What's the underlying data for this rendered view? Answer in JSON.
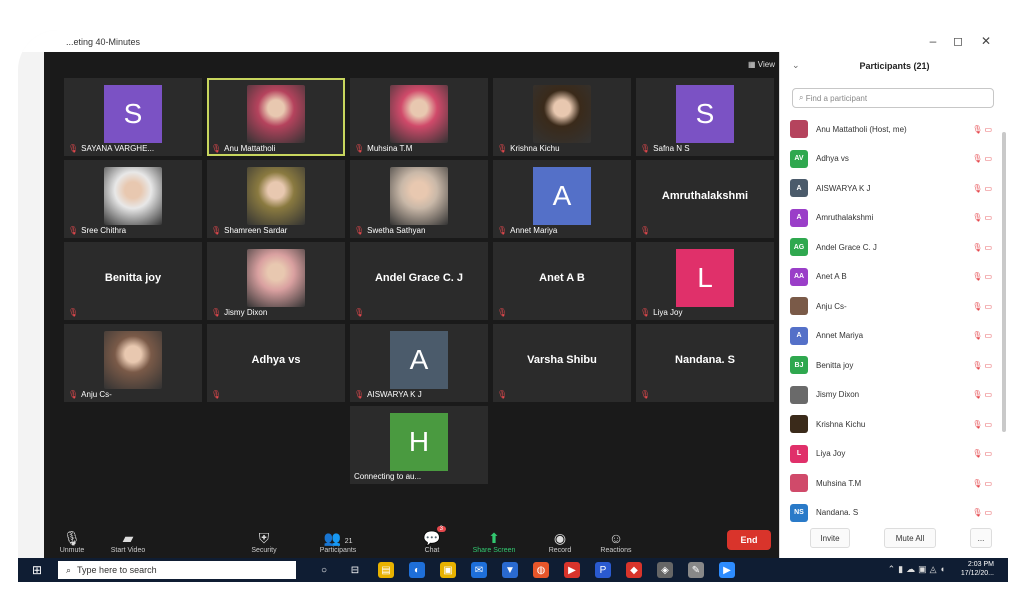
{
  "window": {
    "title": "...eting 40-Minutes",
    "minimize_icon": "–",
    "restore_icon": "◻",
    "close_icon": "✕"
  },
  "meeting": {
    "view_label": "View",
    "tiles": [
      {
        "name": "SAYANA VARGHE...",
        "avatar": "S",
        "color": "#7b52c4"
      },
      {
        "name": "Anu Mattatholi",
        "photo": true,
        "color": "#b5435d",
        "active": true
      },
      {
        "name": "Muhsina T.M",
        "photo": true,
        "color": "#d04a6a"
      },
      {
        "name": "Krishna Kichu",
        "photo": true,
        "color": "#3a2a1a"
      },
      {
        "name": "Safna N S",
        "avatar": "S",
        "color": "#7b52c4"
      },
      {
        "name": "Sree Chithra",
        "photo": true,
        "color": "#e8e8e8"
      },
      {
        "name": "Shamreen Sardar",
        "photo": true,
        "color": "#8a7a40"
      },
      {
        "name": "Swetha Sathyan",
        "photo": true,
        "color": "#c9b8a8"
      },
      {
        "name": "Annet Mariya",
        "avatar": "A",
        "color": "#5470c8"
      },
      {
        "name": "",
        "bigname": "Amruthalakshmi"
      },
      {
        "name": "",
        "bigname": "Benitta joy"
      },
      {
        "name": "Jismy Dixon",
        "photo": true,
        "color": "#d9a0a0"
      },
      {
        "name": "",
        "bigname": "Andel Grace  C. J"
      },
      {
        "name": "",
        "bigname": "Anet A B"
      },
      {
        "name": "Liya Joy",
        "avatar": "L",
        "color": "#e0306a"
      },
      {
        "name": "Anju Cs-",
        "photo": true,
        "color": "#7a5a48"
      },
      {
        "name": "",
        "bigname": "Adhya vs"
      },
      {
        "name": "AISWARYA K J",
        "avatar": "A",
        "color": "#4b5b6b"
      },
      {
        "name": "",
        "bigname": "Varsha Shibu"
      },
      {
        "name": "",
        "bigname": "Nandana. S"
      },
      {
        "name": "Connecting to au...",
        "avatar": "H",
        "color": "#4a9a40",
        "nomic": true
      }
    ]
  },
  "toolbar": {
    "unmute": "Unmute",
    "start_video": "Start Video",
    "security": "Security",
    "participants": "Participants",
    "participants_count": "21",
    "chat": "Chat",
    "chat_badge": "3",
    "share_screen": "Share Screen",
    "record": "Record",
    "reactions": "Reactions",
    "end": "End"
  },
  "panel": {
    "title": "Participants (21)",
    "search_placeholder": "Find a participant",
    "participants": [
      {
        "name": "Anu Mattatholi (Host, me)",
        "initials": "",
        "color": "#b5435d"
      },
      {
        "name": "Adhya vs",
        "initials": "AV",
        "color": "#2fa84f"
      },
      {
        "name": "AISWARYA K J",
        "initials": "A",
        "color": "#4b5b6b"
      },
      {
        "name": "Amruthalakshmi",
        "initials": "A",
        "color": "#9a3ec8"
      },
      {
        "name": "Andel Grace  C. J",
        "initials": "AG",
        "color": "#2fa84f"
      },
      {
        "name": "Anet A B",
        "initials": "AA",
        "color": "#9a3ec8"
      },
      {
        "name": "Anju Cs-",
        "initials": "",
        "color": "#7a5a48"
      },
      {
        "name": "Annet Mariya",
        "initials": "A",
        "color": "#5470c8"
      },
      {
        "name": "Benitta joy",
        "initials": "BJ",
        "color": "#2fa84f"
      },
      {
        "name": "Jismy Dixon",
        "initials": "",
        "color": "#6a6a6a"
      },
      {
        "name": "Krishna Kichu",
        "initials": "",
        "color": "#3a2a1a"
      },
      {
        "name": "Liya Joy",
        "initials": "L",
        "color": "#e0306a"
      },
      {
        "name": "Muhsina T.M",
        "initials": "",
        "color": "#d04a6a"
      },
      {
        "name": "Nandana. S",
        "initials": "NS",
        "color": "#2a7ac8"
      }
    ],
    "invite": "Invite",
    "mute_all": "Mute All",
    "more": "..."
  },
  "taskbar": {
    "search_placeholder": "Type here to search",
    "time": "2:03 PM",
    "date": "17/12/20..."
  }
}
